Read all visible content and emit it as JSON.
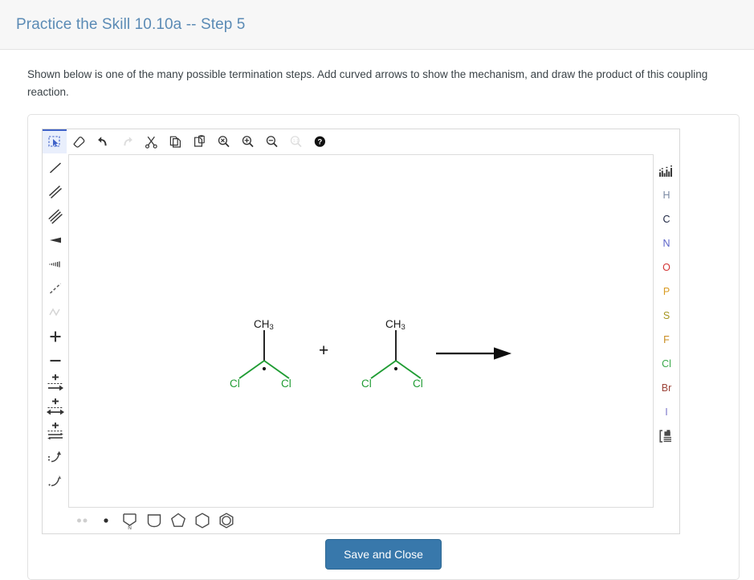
{
  "header": {
    "title": "Practice the Skill 10.10a -- Step 5"
  },
  "prompt": {
    "text": "Shown below is one of the many possible termination steps. Add curved arrows to show the mechanism, and draw the product of this coupling reaction."
  },
  "toolbar_top": {
    "items": [
      {
        "name": "select-tool",
        "label": "Select",
        "active": true,
        "disabled": false
      },
      {
        "name": "eraser-tool",
        "label": "Erase",
        "active": false,
        "disabled": false
      },
      {
        "name": "undo-button",
        "label": "Undo",
        "active": false,
        "disabled": false
      },
      {
        "name": "redo-button",
        "label": "Redo",
        "active": false,
        "disabled": true
      },
      {
        "name": "cut-button",
        "label": "Cut",
        "active": false,
        "disabled": false
      },
      {
        "name": "copy-button",
        "label": "Copy",
        "active": false,
        "disabled": false
      },
      {
        "name": "paste-button",
        "label": "Paste",
        "active": false,
        "disabled": false
      },
      {
        "name": "zoom-fit-button",
        "label": "Zoom to fit",
        "active": false,
        "disabled": false
      },
      {
        "name": "zoom-in-button",
        "label": "Zoom in",
        "active": false,
        "disabled": false
      },
      {
        "name": "zoom-out-button",
        "label": "Zoom out",
        "active": false,
        "disabled": false
      },
      {
        "name": "zoom-reset-button",
        "label": "Zoom 100%",
        "active": false,
        "disabled": true
      },
      {
        "name": "help-button",
        "label": "Help",
        "active": false,
        "disabled": false
      }
    ]
  },
  "toolbar_left": {
    "items": [
      {
        "name": "single-bond-tool",
        "label": "Single bond"
      },
      {
        "name": "double-bond-tool",
        "label": "Double bond"
      },
      {
        "name": "triple-bond-tool",
        "label": "Triple bond"
      },
      {
        "name": "wedge-bond-tool",
        "label": "Wedge bond"
      },
      {
        "name": "hash-bond-tool",
        "label": "Hash bond"
      },
      {
        "name": "dashed-bond-tool",
        "label": "Dashed bond"
      },
      {
        "name": "chain-tool",
        "label": "Chain",
        "disabled": true
      },
      {
        "name": "plus-charge-tool",
        "label": "Positive charge"
      },
      {
        "name": "minus-charge-tool",
        "label": "Negative charge"
      },
      {
        "name": "reaction-arrow-tool",
        "label": "Reaction arrow"
      },
      {
        "name": "resonance-arrow-tool",
        "label": "Resonance arrow"
      },
      {
        "name": "equilibrium-arrow-tool",
        "label": "Equilibrium arrow"
      },
      {
        "name": "curved-arrow-tool",
        "label": "Curved arrow (two electrons)"
      },
      {
        "name": "fishhook-arrow-tool",
        "label": "Fishhook arrow (single electron)"
      }
    ]
  },
  "toolbar_right": {
    "periodic_table_label": "Periodic table",
    "template_label": "Templates",
    "elements": [
      {
        "name": "element-h",
        "symbol": "H",
        "color": "#7b8aa3"
      },
      {
        "name": "element-c",
        "symbol": "C",
        "color": "#1b2340"
      },
      {
        "name": "element-n",
        "symbol": "N",
        "color": "#5b63c9"
      },
      {
        "name": "element-o",
        "symbol": "O",
        "color": "#d33434"
      },
      {
        "name": "element-p",
        "symbol": "P",
        "color": "#d99b22"
      },
      {
        "name": "element-s",
        "symbol": "S",
        "color": "#a5951f"
      },
      {
        "name": "element-f",
        "symbol": "F",
        "color": "#c98c20"
      },
      {
        "name": "element-cl",
        "symbol": "Cl",
        "color": "#3aa94a"
      },
      {
        "name": "element-br",
        "symbol": "Br",
        "color": "#9c4338"
      },
      {
        "name": "element-i",
        "symbol": "I",
        "color": "#7a76c9"
      }
    ]
  },
  "toolbar_bottom": {
    "items": [
      {
        "name": "lone-pair-tool",
        "label": "Lone pair",
        "disabled": true
      },
      {
        "name": "radical-tool",
        "label": "Radical electron",
        "disabled": false
      },
      {
        "name": "pyrrole-template",
        "label": "Pyrrole ring",
        "disabled": false,
        "hetero": "N"
      },
      {
        "name": "cyclobutane-template",
        "label": "Cyclobutane ring",
        "disabled": false
      },
      {
        "name": "cyclopentane-template",
        "label": "Cyclopentane ring",
        "disabled": false
      },
      {
        "name": "cyclohexane-template",
        "label": "Cyclohexane ring",
        "disabled": false
      },
      {
        "name": "benzene-template",
        "label": "Benzene ring",
        "disabled": false
      }
    ]
  },
  "canvas": {
    "reaction": {
      "plus_sign": "+",
      "reactants": [
        {
          "name": "dichloromethyl-radical-1",
          "top_label": "CH",
          "top_sub": "3",
          "left_label": "Cl",
          "right_label": "Cl",
          "radical": true
        },
        {
          "name": "dichloromethyl-radical-2",
          "top_label": "CH",
          "top_sub": "3",
          "left_label": "Cl",
          "right_label": "Cl",
          "radical": true
        }
      ],
      "arrow_label": ""
    }
  },
  "footer": {
    "save_label": "Save and Close"
  },
  "colors": {
    "accent_blue": "#3878ab",
    "title_blue": "#5b8bb5",
    "chlorine_green": "#1f9c33",
    "active_tool_bg": "#e9effc",
    "active_tool_border": "#3f62c8"
  }
}
